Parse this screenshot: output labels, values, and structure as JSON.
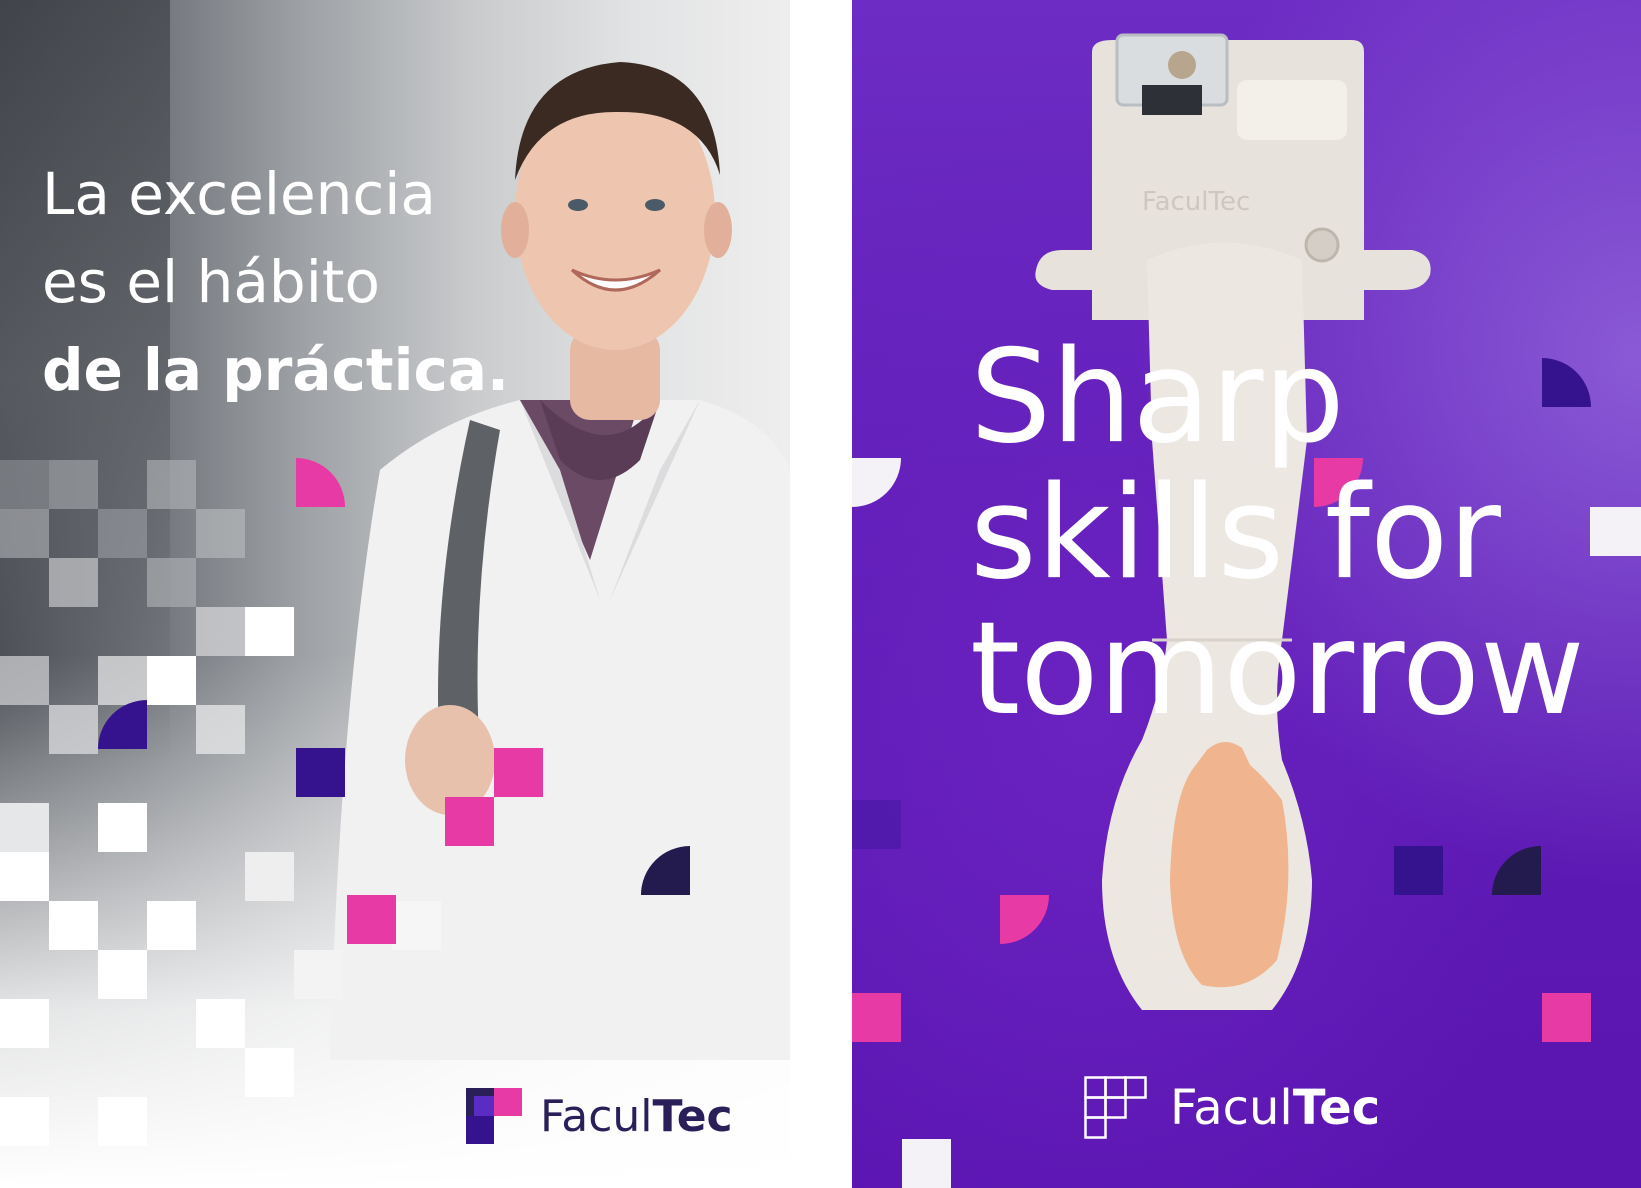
{
  "left_poster": {
    "headline": {
      "line1": "La excelencia",
      "line2": "es el hábito",
      "line3": "de la práctica."
    },
    "logo": {
      "brand_light": "Facul",
      "brand_bold": "Tec"
    }
  },
  "right_poster": {
    "headline": {
      "line1": "Sharp",
      "line2": "skills for",
      "line3": "tomorrow"
    },
    "device_engraving": "FaculTec",
    "logo": {
      "brand_light": "Facul",
      "brand_bold": "Tec"
    }
  },
  "colors": {
    "pink": "#e83aa4",
    "indigo": "#35138f",
    "navy": "#231b4e",
    "purple": "#5f1db6",
    "white": "#ffffff"
  },
  "icons": [
    "facultec-logo-icon",
    "facultec-grid-logo-icon"
  ]
}
